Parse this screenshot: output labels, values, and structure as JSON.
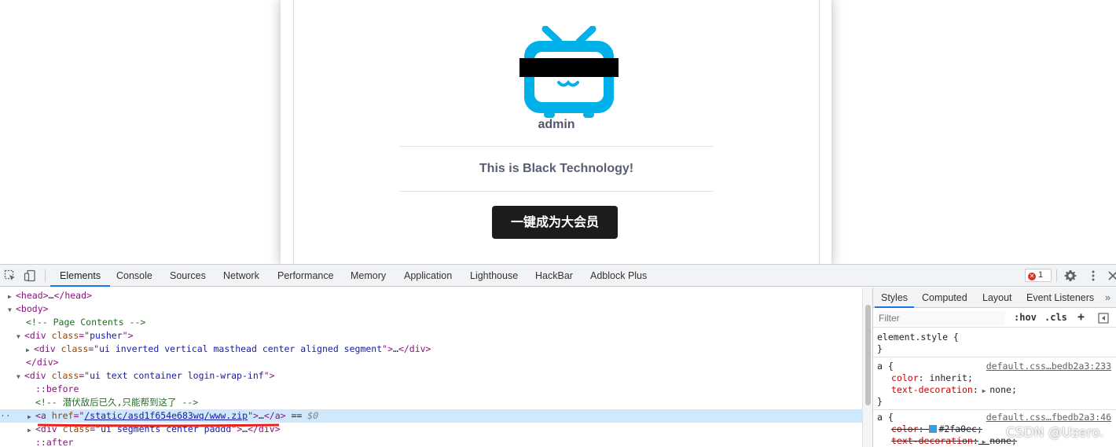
{
  "page": {
    "username": "admin",
    "tagline": "This is Black Technology!",
    "vip_button": "一键成为大会员",
    "colors": {
      "logo_blue": "#00b0e8",
      "button_bg": "#1b1c1d",
      "censor_bar": "#000000"
    }
  },
  "devtools": {
    "tabs": [
      "Elements",
      "Console",
      "Sources",
      "Network",
      "Performance",
      "Memory",
      "Application",
      "Lighthouse",
      "HackBar",
      "Adblock Plus"
    ],
    "active_tab": "Elements",
    "error_count": "1",
    "elements": {
      "l0": {
        "tag_open": "<head>",
        "ellipsis": "…",
        "tag_close": "</head>"
      },
      "l1": {
        "tag": "<body>"
      },
      "l2": {
        "comment": "<!-- Page Contents -->"
      },
      "l3": {
        "tag_start": "<div ",
        "attr": "class",
        "eq": "=\"",
        "value": "pusher",
        "end": "\">"
      },
      "l4": {
        "tag_start": "<div ",
        "attr": "class",
        "eq": "=\"",
        "value": "ui inverted vertical masthead center aligned segment",
        "end": "\">",
        "ellipsis": "…",
        "close": "</div>"
      },
      "l5": {
        "tag": "</div>"
      },
      "l6": {
        "tag_start": "<div ",
        "attr": "class",
        "eq": "=\"",
        "value": "ui text container login-wrap-inf",
        "end": "\">"
      },
      "l7": {
        "pseudo": "::before"
      },
      "l8": {
        "comment": "<!-- 潜伏敌后已久,只能帮到这了 -->"
      },
      "l9": {
        "tag_start": "<a ",
        "attr": "href",
        "eq": "=\"",
        "value": "/static/asd1f654e683wq/www.zip",
        "end": "\">",
        "ellipsis": "…",
        "close": "</a>",
        "eqeq": " == ",
        "dollar": "$0",
        "dots": "··"
      },
      "l10": {
        "tag_start": "<div ",
        "attr": "class",
        "eq": "=\"",
        "value": "ui segments center paddd",
        "end": "\">",
        "ellipsis": "…",
        "close": "</div>"
      },
      "l11": {
        "pseudo": "::after"
      }
    },
    "styles": {
      "tabs": [
        "Styles",
        "Computed",
        "Layout",
        "Event Listeners"
      ],
      "active_tab": "Styles",
      "filter_placeholder": "Filter",
      "hov": ":hov",
      "cls": ".cls",
      "element_style_open": "element.style {",
      "close_brace": "}",
      "rule1": {
        "selector": "a {",
        "source": "default.css…bedb2a3:233",
        "p1_name": "color",
        "p1_value": "inherit;",
        "p2_name": "text-decoration",
        "p2_value": "none;"
      },
      "rule2": {
        "selector": "a {",
        "source": "default.css…fbedb2a3:46",
        "p1_name": "color",
        "p1_value": "#2fa0ec;",
        "p2_name": "text-decoration",
        "p2_value": "none;"
      }
    }
  },
  "watermark": "CSDN @Uzero."
}
